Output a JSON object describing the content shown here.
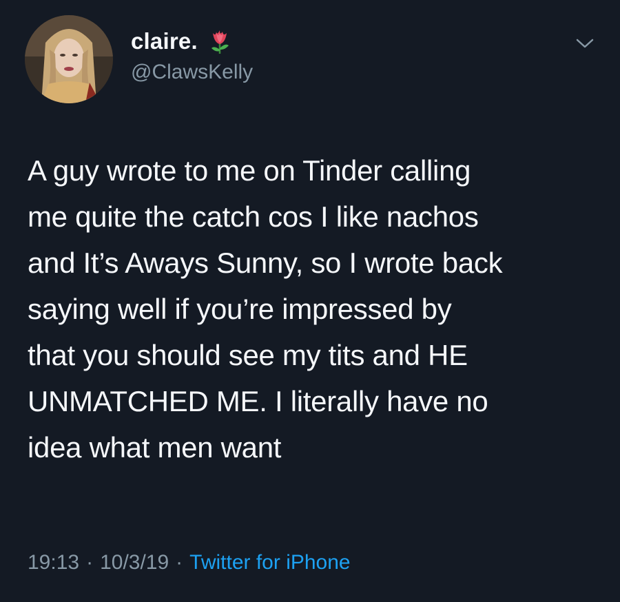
{
  "tweet": {
    "display_name": "claire.",
    "handle": "@ClawsKelly",
    "text": "A guy wrote to me on Tinder calling\nme quite the catch cos I like nachos\nand It’s Aways Sunny, so I wrote back\nsaying well if you’re impressed by\nthat you should see my tits and HE\nUNMATCHED ME. I literally have no\nidea what men want",
    "time": "19:13",
    "separator": "·",
    "date": "10/3/19",
    "source": "Twitter for iPhone"
  },
  "icons": {
    "name_emoji": "tulip-icon",
    "menu": "chevron-down-icon"
  },
  "colors": {
    "background": "#141a24",
    "primary_text": "#f5f7fa",
    "secondary_text": "#8899a6",
    "link": "#1da1f2"
  }
}
